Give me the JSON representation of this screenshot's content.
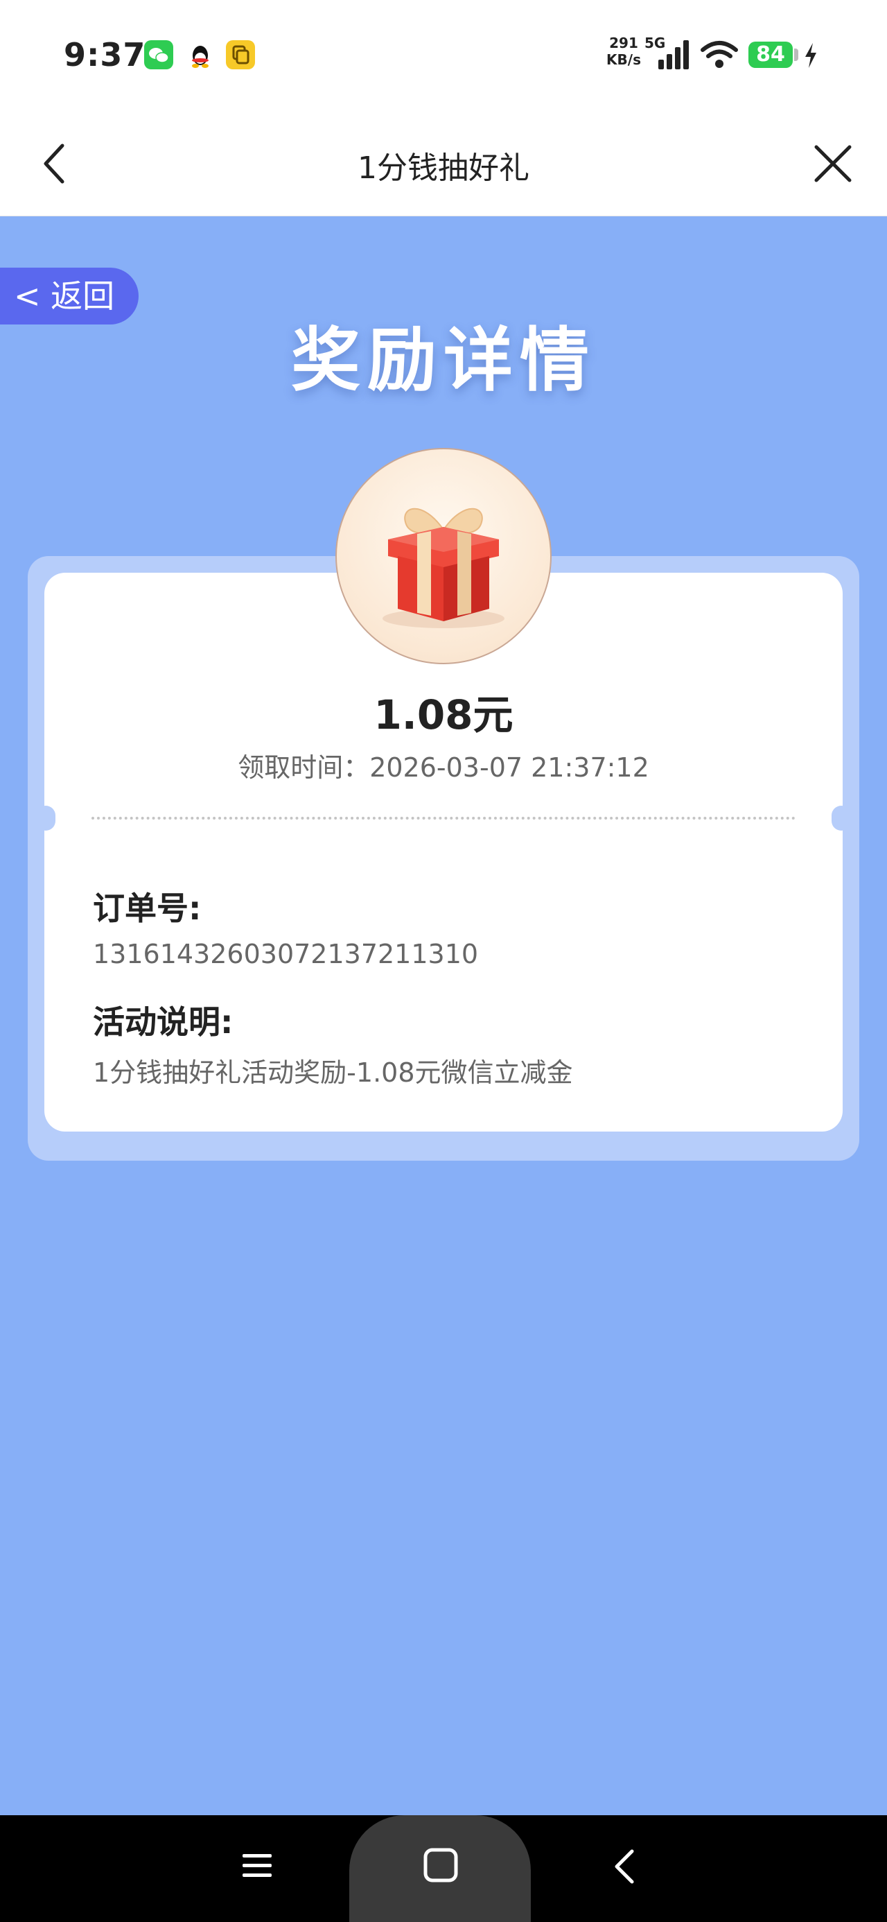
{
  "status_bar": {
    "time": "9:37",
    "net_speed_value": "291",
    "net_speed_unit": "KB/s",
    "network_type": "5G",
    "battery_level": "84",
    "notification_icons": [
      "wechat-icon",
      "qq-icon",
      "files-icon"
    ]
  },
  "nav": {
    "title": "1分钱抽好礼",
    "back_icon": "chevron-left-icon",
    "close_icon": "close-icon"
  },
  "page": {
    "back_button_label": "< 返回",
    "heading": "奖励详情"
  },
  "reward": {
    "amount": "1.08元",
    "claim_time": "领取时间：2026-03-07 21:37:12",
    "order_label": "订单号:",
    "order_number": "131614326030721372113​10",
    "description_label": "活动说明:",
    "description": "1分钱抽好礼活动奖励-1.08元微信立减金"
  },
  "colors": {
    "page_background": "#87aff7",
    "card_frame": "#b6cdfa",
    "back_pill": "#5a68ee",
    "battery": "#2ecc52"
  }
}
